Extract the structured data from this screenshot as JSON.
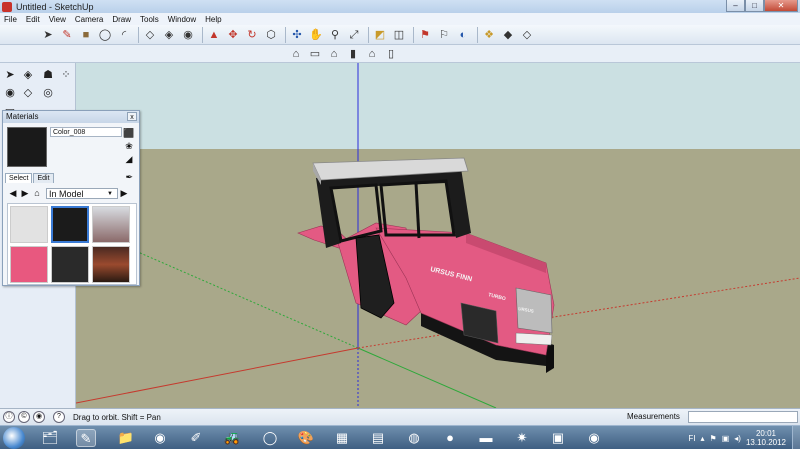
{
  "window": {
    "title": "Untitled - SketchUp",
    "controls": [
      "–",
      "□",
      "✕"
    ]
  },
  "menu": {
    "items": [
      "File",
      "Edit",
      "View",
      "Camera",
      "Draw",
      "Tools",
      "Window",
      "Help"
    ]
  },
  "toolbar": {
    "row1_icons": [
      "select-icon",
      "pencil-icon",
      "rectangle-icon",
      "circle-icon",
      "arc-icon",
      "eraser-icon",
      "tape-icon",
      "paint-icon",
      "push-pull-icon",
      "move-icon",
      "rotate-icon",
      "offset-icon",
      "orbit-icon",
      "pan-icon",
      "zoom-icon",
      "zoom-extents-icon",
      "section-icon",
      "walk-icon",
      "position-camera-icon",
      "look-around-icon",
      "3d-text-icon",
      "components-icon",
      "materials-icon",
      "styles-icon"
    ],
    "row2_icons": [
      "iso-view-icon",
      "top-view-icon",
      "front-view-icon",
      "right-view-icon",
      "back-view-icon",
      "left-view-icon"
    ]
  },
  "materials_panel": {
    "title": "Materials",
    "close": "x",
    "current_name": "Color_008",
    "tabs": [
      "Select",
      "Edit"
    ],
    "collection": "In Model",
    "swatches": [
      {
        "label": "light-grey",
        "color": "#e2e2e2"
      },
      {
        "label": "black",
        "color": "#1b1b1b"
      },
      {
        "label": "tractor-texture",
        "color": "#8b6a6a"
      },
      {
        "label": "pink-texture",
        "color": "#e8587f"
      },
      {
        "label": "dark-texture",
        "color": "#2a2a2a"
      },
      {
        "label": "photo-texture",
        "color": "#6b3b2a"
      }
    ]
  },
  "model": {
    "body_color": "#e35a83",
    "cab_color": "#1c1c1c",
    "roof_color": "#d9d9d9",
    "brand_text": "URSUS FINN",
    "model_text": "TURBO",
    "hood_text": "URSUS"
  },
  "colors": {
    "sky": "#cbe0e2",
    "ground": "#a9a88a",
    "axis_blue": "#2b2bd9",
    "axis_red": "#c53a2e",
    "axis_green": "#2ea83a"
  },
  "status": {
    "hint": "Drag to orbit.  Shift = Pan",
    "measurements_label": "Measurements",
    "measurements_value": ""
  },
  "taskbar": {
    "time": "20:01",
    "date": "13.10.2012",
    "lang": "FI"
  }
}
